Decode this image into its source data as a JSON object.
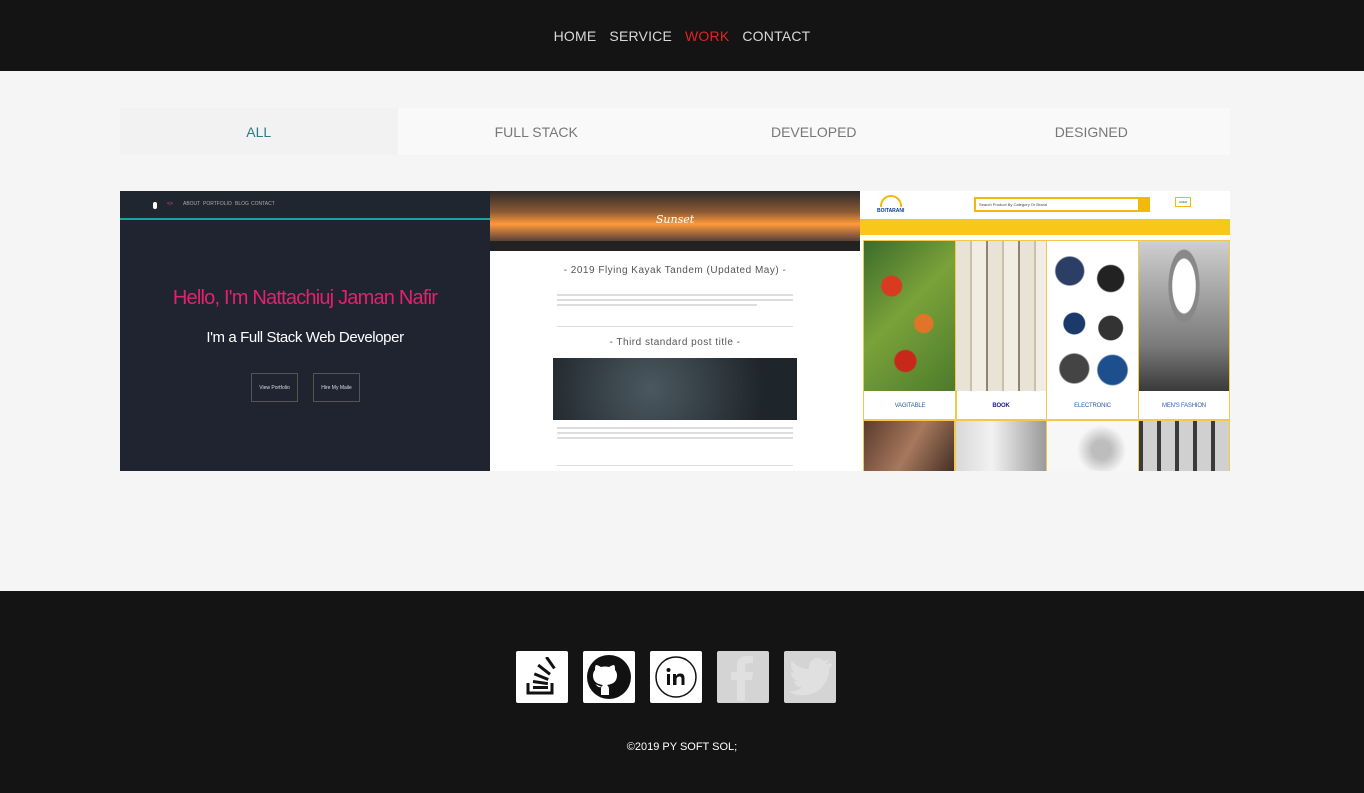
{
  "nav": {
    "items": [
      {
        "label": "HOME",
        "active": false
      },
      {
        "label": "SERVICE",
        "active": false
      },
      {
        "label": "WORK",
        "active": true
      },
      {
        "label": "CONTACT",
        "active": false
      }
    ],
    "active_color": "#e02424"
  },
  "filters": [
    {
      "label": "ALL",
      "active": true
    },
    {
      "label": "FULL STACK",
      "active": false
    },
    {
      "label": "DEVELOPED",
      "active": false
    },
    {
      "label": "DESIGNED",
      "active": false
    }
  ],
  "projects": {
    "portfolio": {
      "nav": [
        "ABOUT",
        "PORTFOLIO",
        "BLOG",
        "CONTACT"
      ],
      "headline": "Hello, I'm Nattachiuj Jaman Nafir",
      "subheadline": "I'm a Full Stack Web Developer",
      "buttons": [
        "View Portfolio",
        "Hire My Maile"
      ],
      "accent": "#e3226f"
    },
    "blog": {
      "brand": "Sunset",
      "post1_title": "- 2019 Flying Kayak Tandem (Updated May) -",
      "post2_title": "- Third standard post title -"
    },
    "shop": {
      "brand": "BOITARANI",
      "search_placeholder": "Search Product By Category Or Brand",
      "categories": [
        {
          "label": "VAGITABLE",
          "icon": "vegetables-image"
        },
        {
          "label": "BOOK",
          "icon": "books-image"
        },
        {
          "label": "ELECTRONIC",
          "icon": "electronics-image"
        },
        {
          "label": "MEN'S FASHION",
          "icon": "fashion-image"
        }
      ],
      "accent": "#f7c719"
    }
  },
  "footer": {
    "social": [
      {
        "name": "stackoverflow-icon"
      },
      {
        "name": "github-icon"
      },
      {
        "name": "linkedin-icon"
      },
      {
        "name": "facebook-icon"
      },
      {
        "name": "twitter-icon"
      }
    ],
    "copyright": "©2019 PY SOFT SOL;"
  }
}
